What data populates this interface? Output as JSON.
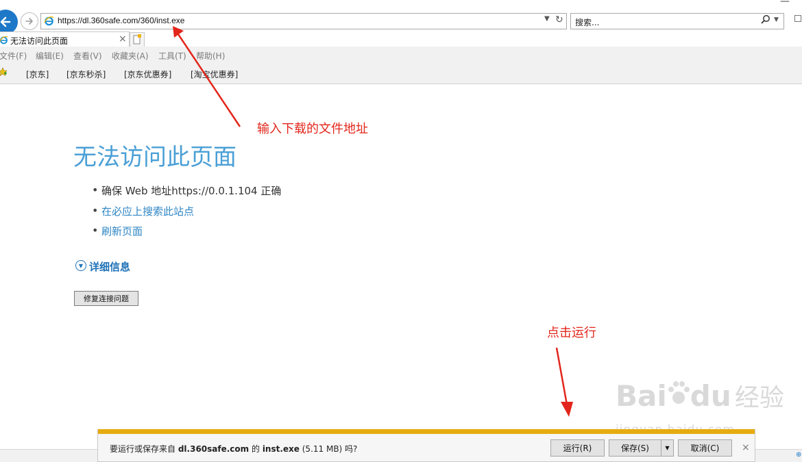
{
  "browser": {
    "address_url": "https://dl.360safe.com/360/inst.exe",
    "search_placeholder": "搜索...",
    "tab_title": "无法访问此页面"
  },
  "menu": [
    "文件(F)",
    "编辑(E)",
    "查看(V)",
    "收藏夹(A)",
    "工具(T)",
    "帮助(H)"
  ],
  "favorites": [
    "[京东]",
    "[京东秒杀]",
    "[京东优惠券]",
    "[淘宝优惠券]"
  ],
  "error_page": {
    "title": "无法访问此页面",
    "bullets": [
      "确保 Web 地址https://0.0.1.104 正确",
      "在必应上搜索此站点",
      "刷新页面"
    ],
    "more_info": "详细信息",
    "fix_button": "修复连接问题"
  },
  "annotations": {
    "address_hint": "输入下载的文件地址",
    "run_hint": "点击运行"
  },
  "download_bar": {
    "msg_prefix": "要运行或保存来自 ",
    "domain": "dl.360safe.com",
    "msg_mid": " 的 ",
    "filename": "inst.exe",
    "size": " (5.11 MB) 吗?",
    "run_label": "运行(R)",
    "save_label": "保存(S)",
    "cancel_label": "取消(C)"
  },
  "watermark": {
    "brand": "Bai",
    "brand_tail": "du",
    "cn": "经验",
    "url": "jingyan.baidu.com"
  },
  "colors": {
    "title_blue": "#4a9fd6",
    "link_blue": "#1f72b8",
    "annotation_red": "#e2261b",
    "progress_yellow": "#e6ac0f"
  },
  "icons": [
    "back-arrow-icon",
    "forward-arrow-icon",
    "ie-logo-icon",
    "refresh-icon",
    "search-icon",
    "close-icon",
    "new-tab-icon",
    "favorites-star-icon",
    "chevron-down-icon"
  ]
}
